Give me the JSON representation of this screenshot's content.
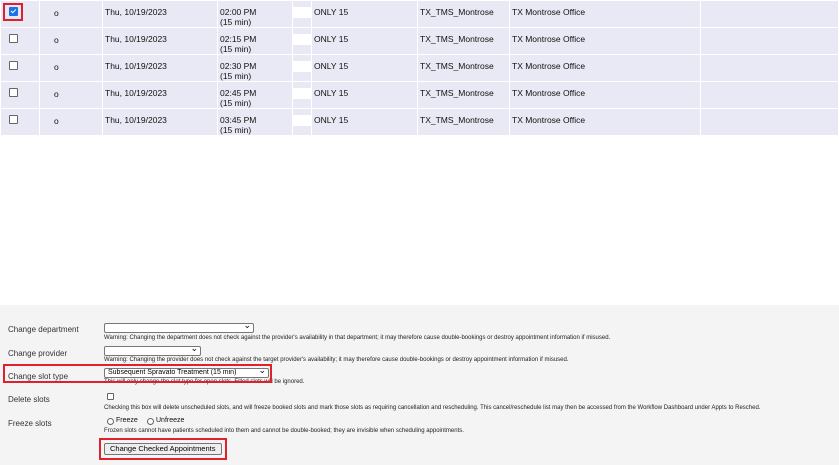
{
  "slots": [
    {
      "checked": true,
      "status": "o",
      "date": "Thu, 10/19/2023",
      "time": "02:00 PM",
      "duration": "(15 min)",
      "visit_type": "ONLY 15",
      "department": "TX_TMS_Montrose",
      "location": "TX Montrose Office"
    },
    {
      "checked": false,
      "status": "o",
      "date": "Thu, 10/19/2023",
      "time": "02:15 PM",
      "duration": "(15 min)",
      "visit_type": "ONLY 15",
      "department": "TX_TMS_Montrose",
      "location": "TX Montrose Office"
    },
    {
      "checked": false,
      "status": "o",
      "date": "Thu, 10/19/2023",
      "time": "02:30 PM",
      "duration": "(15 min)",
      "visit_type": "ONLY 15",
      "department": "TX_TMS_Montrose",
      "location": "TX Montrose Office"
    },
    {
      "checked": false,
      "status": "o",
      "date": "Thu, 10/19/2023",
      "time": "02:45 PM",
      "duration": "(15 min)",
      "visit_type": "ONLY 15",
      "department": "TX_TMS_Montrose",
      "location": "TX Montrose Office"
    },
    {
      "checked": false,
      "status": "o",
      "date": "Thu, 10/19/2023",
      "time": "03:45 PM",
      "duration": "(15 min)",
      "visit_type": "ONLY 15",
      "department": "TX_TMS_Montrose",
      "location": "TX Montrose Office"
    }
  ],
  "form": {
    "change_department": {
      "label": "Change department",
      "value": "",
      "warning": "Warning: Changing the department does not check against the provider's availability in that department; it may therefore cause double-bookings or destroy appointment information if misused."
    },
    "change_provider": {
      "label": "Change provider",
      "value": "",
      "warning": "Warning: Changing the provider does not check against the target provider's availability; it may therefore cause double-bookings or destroy appointment information if misused."
    },
    "change_slot_type": {
      "label": "Change slot type",
      "value": "Subsequent Spravato Treatment (15 min)",
      "note": "This will only change the slot type for open slots. Filled slots will be ignored."
    },
    "delete_slots": {
      "label": "Delete slots",
      "checked": false,
      "note": "Checking this box will delete unscheduled slots, and will freeze booked slots and mark those slots as requiring cancellation and rescheduling. This cancel/reschedule list may then be accessed from the Workflow Dashboard under Appts to Resched."
    },
    "freeze_slots": {
      "label": "Freeze slots",
      "freeze_label": "Freeze",
      "unfreeze_label": "Unfreeze",
      "note": "Frozen slots cannot have patients scheduled into them and cannot be double-booked; they are invisible when scheduling appointments."
    },
    "submit_label": "Change Checked Appointments"
  },
  "colors": {
    "row_bg": "#e9e9f5",
    "panel_bg": "#f4f4f4",
    "highlight": "#e0212b",
    "checkbox_checked": "#1a73e8"
  }
}
